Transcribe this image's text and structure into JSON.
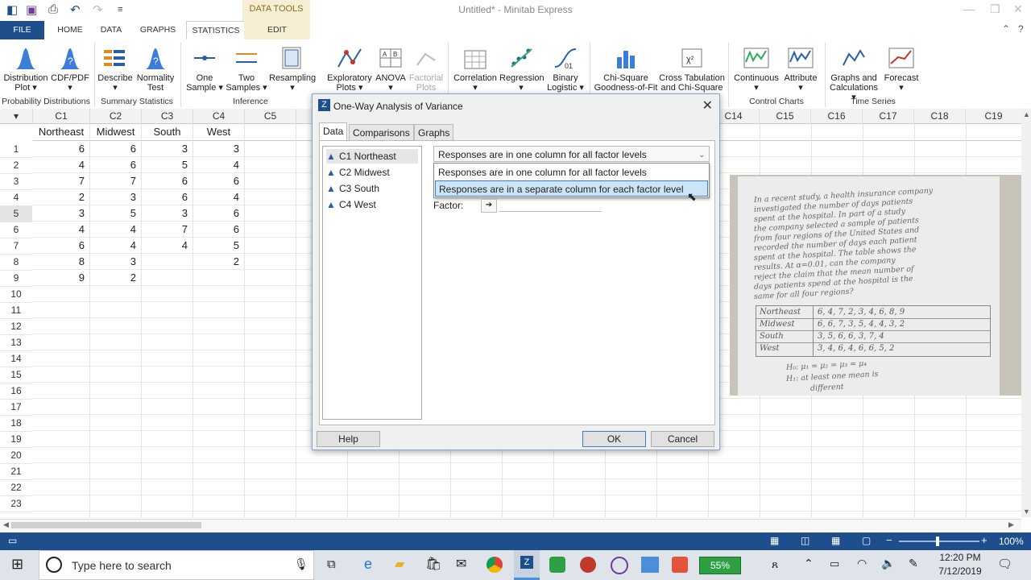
{
  "app": {
    "title": "Untitled* - Minitab Express",
    "context_band": "DATA TOOLS"
  },
  "ribbon_tabs": [
    "FILE",
    "HOME",
    "DATA",
    "GRAPHS",
    "STATISTICS",
    "EDIT"
  ],
  "ribbon": {
    "buttons": [
      {
        "l1": "Distribution",
        "l2": "Plot ▾"
      },
      {
        "l1": "CDF/PDF",
        "l2": "▾"
      },
      {
        "l1": "Describe",
        "l2": "▾"
      },
      {
        "l1": "Normality",
        "l2": "Test"
      },
      {
        "l1": "One",
        "l2": "Sample ▾"
      },
      {
        "l1": "Two",
        "l2": "Samples ▾"
      },
      {
        "l1": "Resampling",
        "l2": "▾"
      },
      {
        "l1": "Exploratory",
        "l2": "Plots ▾"
      },
      {
        "l1": "ANOVA",
        "l2": "▾"
      },
      {
        "l1": "Factorial",
        "l2": "Plots"
      },
      {
        "l1": "Correlation",
        "l2": "▾"
      },
      {
        "l1": "Regression",
        "l2": "▾"
      },
      {
        "l1": "Binary",
        "l2": "Logistic ▾"
      },
      {
        "l1": "Chi-Square",
        "l2": "Goodness-of-Fit"
      },
      {
        "l1": "Cross Tabulation",
        "l2": "and Chi-Square"
      },
      {
        "l1": "Continuous",
        "l2": "▾"
      },
      {
        "l1": "Attribute",
        "l2": "▾"
      },
      {
        "l1": "Graphs and",
        "l2": "Calculations ▾"
      },
      {
        "l1": "Forecast",
        "l2": "▾"
      }
    ],
    "groups": [
      "Probability Distributions",
      "Summary Statistics",
      "Inference",
      "Control Charts",
      "Time Series"
    ]
  },
  "sheet": {
    "columns": [
      "C1",
      "C2",
      "C3",
      "C4",
      "C5",
      "C14",
      "C15",
      "C16",
      "C17",
      "C18",
      "C19"
    ],
    "names": [
      "Northeast",
      "Midwest",
      "South",
      "West"
    ],
    "rows": [
      "1",
      "2",
      "3",
      "4",
      "5",
      "6",
      "7",
      "8",
      "9",
      "10",
      "11",
      "12",
      "13",
      "14",
      "15",
      "16",
      "17",
      "18",
      "19",
      "20",
      "21",
      "22",
      "23"
    ],
    "data": {
      "c1": [
        "6",
        "4",
        "7",
        "2",
        "3",
        "4",
        "6",
        "8",
        "9"
      ],
      "c2": [
        "6",
        "6",
        "7",
        "3",
        "5",
        "4",
        "4",
        "3",
        "2"
      ],
      "c3": [
        "3",
        "5",
        "6",
        "6",
        "3",
        "7",
        "4"
      ],
      "c4": [
        "3",
        "4",
        "6",
        "4",
        "6",
        "6",
        "5",
        "2"
      ]
    }
  },
  "dialog": {
    "title": "One-Way Analysis of Variance",
    "tabs": [
      "Data",
      "Comparisons",
      "Graphs"
    ],
    "variables": [
      "C1 Northeast",
      "C2 Midwest",
      "C3 South",
      "C4 West"
    ],
    "combo_value": "Responses are in one column for all factor levels",
    "options": [
      "Responses are in one column for all factor levels",
      "Responses are in a separate column for each factor level"
    ],
    "factor_label": "Factor:",
    "help": "Help",
    "ok": "OK",
    "cancel": "Cancel"
  },
  "photo": {
    "lines": [
      "In a recent study, a health insurance company",
      "investigated the number of days patients",
      "spent at the hospital. In part of a study",
      "the company selected a sample of patients",
      "from four regions of the United States and",
      "recorded the number of days each patient",
      "spent at the hospital. The table shows the",
      "results. At α=0.01, can the company",
      "reject the claim that the mean number of",
      "days patients spend at the hospital is the",
      "same for all four regions?"
    ],
    "table": [
      {
        "region": "Northeast",
        "vals": "6, 4, 7, 2, 3, 4, 6, 8, 9"
      },
      {
        "region": "Midwest",
        "vals": "6, 6, 7, 3, 5, 4, 4, 3, 2"
      },
      {
        "region": "South",
        "vals": "3, 5, 6, 6, 3, 7, 4"
      },
      {
        "region": "West",
        "vals": "3, 4, 6, 4, 6, 6, 5, 2"
      }
    ],
    "h0": "H₀: μ₁ = μ₂ = μ₃ = μ₄",
    "h1": "H₁: at least one mean is",
    "h1b": "different"
  },
  "status": {
    "zoom": "100%"
  },
  "taskbar": {
    "search_placeholder": "Type here to search",
    "battery": "55%",
    "time": "12:20 PM",
    "date": "7/12/2019"
  }
}
